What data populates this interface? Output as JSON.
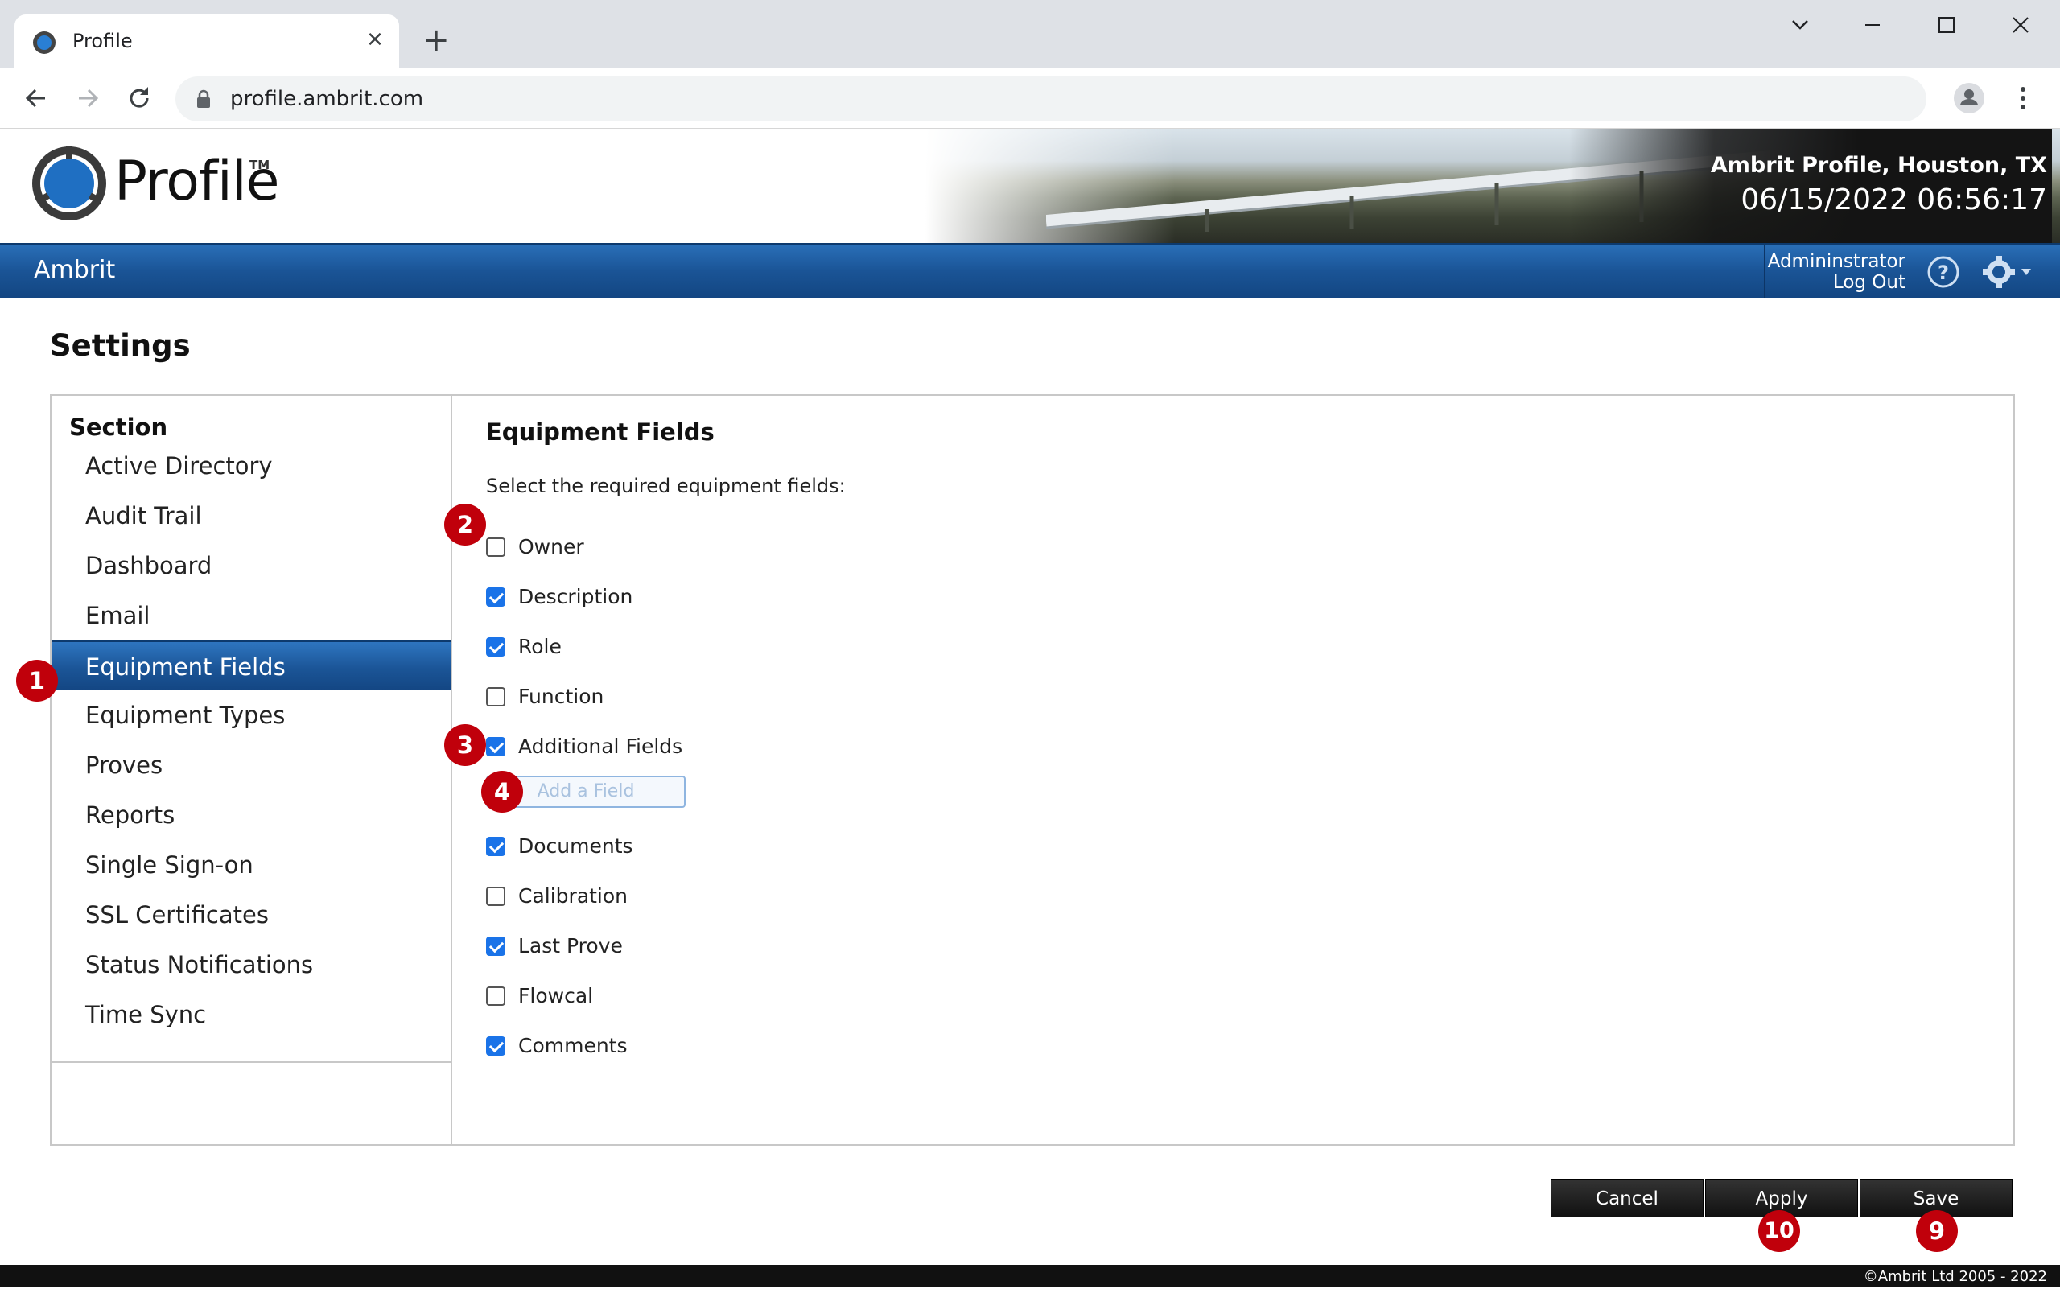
{
  "browser": {
    "tab_title": "Profile",
    "tab_close": "✕",
    "new_tab": "+",
    "url": "profile.ambrit.com"
  },
  "header": {
    "logo_text": "Profile",
    "logo_tm": "TM",
    "site_name": "Ambrit Profile, Houston, TX",
    "datetime": "06/15/2022 06:56:17"
  },
  "navbar": {
    "brand": "Ambrit",
    "user": "Admininstrator",
    "logout": "Log Out"
  },
  "page": {
    "title": "Settings"
  },
  "sidebar": {
    "heading": "Section",
    "items": [
      {
        "label": "Active Directory"
      },
      {
        "label": "Audit Trail"
      },
      {
        "label": "Dashboard"
      },
      {
        "label": "Email"
      },
      {
        "label": "Equipment Fields",
        "active": true
      },
      {
        "label": "Equipment Types"
      },
      {
        "label": "Proves"
      },
      {
        "label": "Reports"
      },
      {
        "label": "Single Sign-on"
      },
      {
        "label": "SSL Certificates"
      },
      {
        "label": "Status Notifications"
      },
      {
        "label": "Time Sync"
      }
    ]
  },
  "content": {
    "title": "Equipment Fields",
    "subtitle": "Select the required equipment fields:",
    "fields": [
      {
        "label": "Owner",
        "checked": false
      },
      {
        "label": "Description",
        "checked": true
      },
      {
        "label": "Role",
        "checked": true
      },
      {
        "label": "Function",
        "checked": false
      },
      {
        "label": "Additional Fields",
        "checked": true
      },
      {
        "label": "Documents",
        "checked": true
      },
      {
        "label": "Calibration",
        "checked": false
      },
      {
        "label": "Last Prove",
        "checked": true
      },
      {
        "label": "Flowcal",
        "checked": false
      },
      {
        "label": "Comments",
        "checked": true
      }
    ],
    "add_field_label": "Add a Field"
  },
  "actions": {
    "cancel": "Cancel",
    "apply": "Apply",
    "save": "Save"
  },
  "badges": {
    "b1": "1",
    "b2": "2",
    "b3": "3",
    "b4": "4",
    "b9": "9",
    "b10": "10"
  },
  "footer": {
    "copyright": "©Ambrit Ltd 2005 - 2022"
  },
  "colors": {
    "nav_blue": "#1a5496",
    "checkbox_blue": "#1a73e8",
    "badge_red": "#c0000b"
  }
}
